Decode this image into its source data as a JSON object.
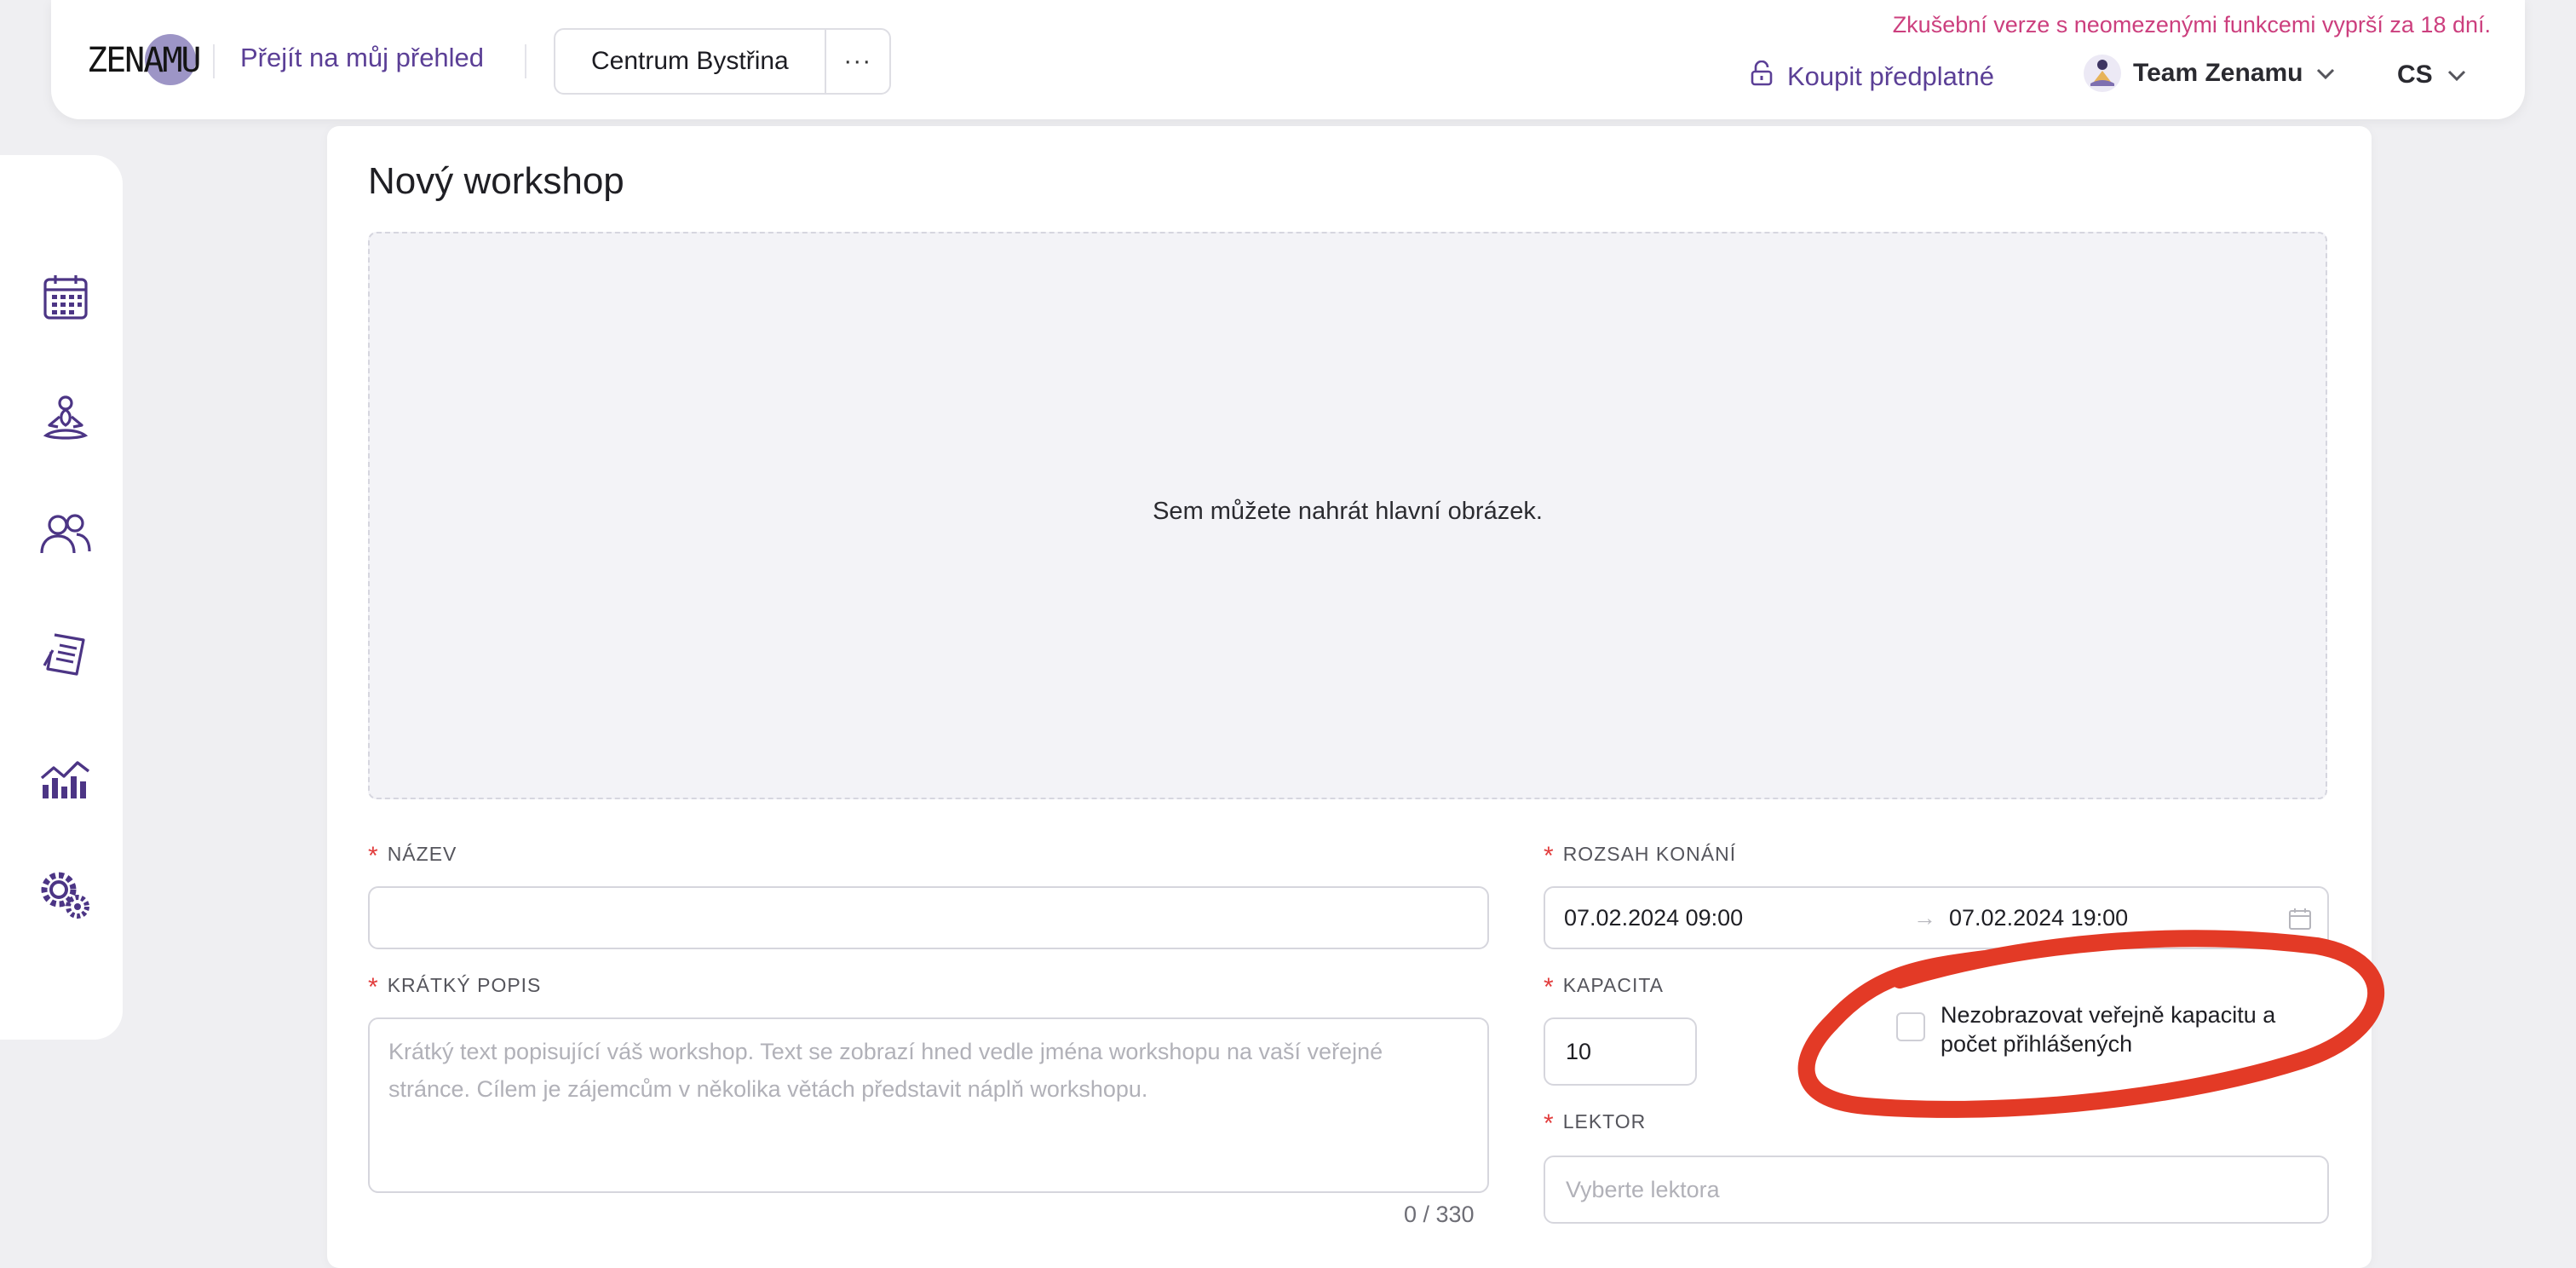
{
  "header": {
    "logo_text": "ZENAMU",
    "overview_link": "Přejít na můj přehled",
    "studio_name": "Centrum Bystřina",
    "studio_more": "···",
    "trial_notice": "Zkušební verze s neomezenými funkcemi vyprší za 18 dní.",
    "buy_subscription": "Koupit předplatné",
    "team_name": "Team Zenamu",
    "language": "CS",
    "accent_color": "#5b3f96",
    "trial_color": "#cc3f7e"
  },
  "sidebar": {
    "items": [
      {
        "icon": "calendar-icon"
      },
      {
        "icon": "yoga-pose-icon"
      },
      {
        "icon": "users-icon"
      },
      {
        "icon": "receipt-icon"
      },
      {
        "icon": "chart-icon"
      },
      {
        "icon": "settings-icon"
      }
    ]
  },
  "page": {
    "title": "Nový workshop",
    "upload_hint": "Sem můžete nahrát hlavní obrázek."
  },
  "form": {
    "name_label": "NÁZEV",
    "name_value": "",
    "short_desc_label": "KRÁTKÝ POPIS",
    "short_desc_placeholder": "Krátký text popisující váš workshop. Text se zobrazí hned vedle jména workshopu na vaší veřejné stránce. Cílem je zájemcům v několika větách představit náplň workshopu.",
    "short_desc_counter": "0 / 330",
    "range_label": "ROZSAH KONÁNÍ",
    "range_start": "07.02.2024 09:00",
    "range_separator": "→",
    "range_end": "07.02.2024 19:00",
    "capacity_label": "KAPACITA",
    "capacity_value": "10",
    "hide_capacity_label": "Nezobrazovat veřejně kapacitu a počet přihlášených",
    "hide_capacity_checked": false,
    "lector_label": "LEKTOR",
    "lector_placeholder": "Vyberte lektora",
    "required_marker": "*",
    "required_color": "#e23d3d"
  },
  "annotation": {
    "color": "#e33a26"
  }
}
